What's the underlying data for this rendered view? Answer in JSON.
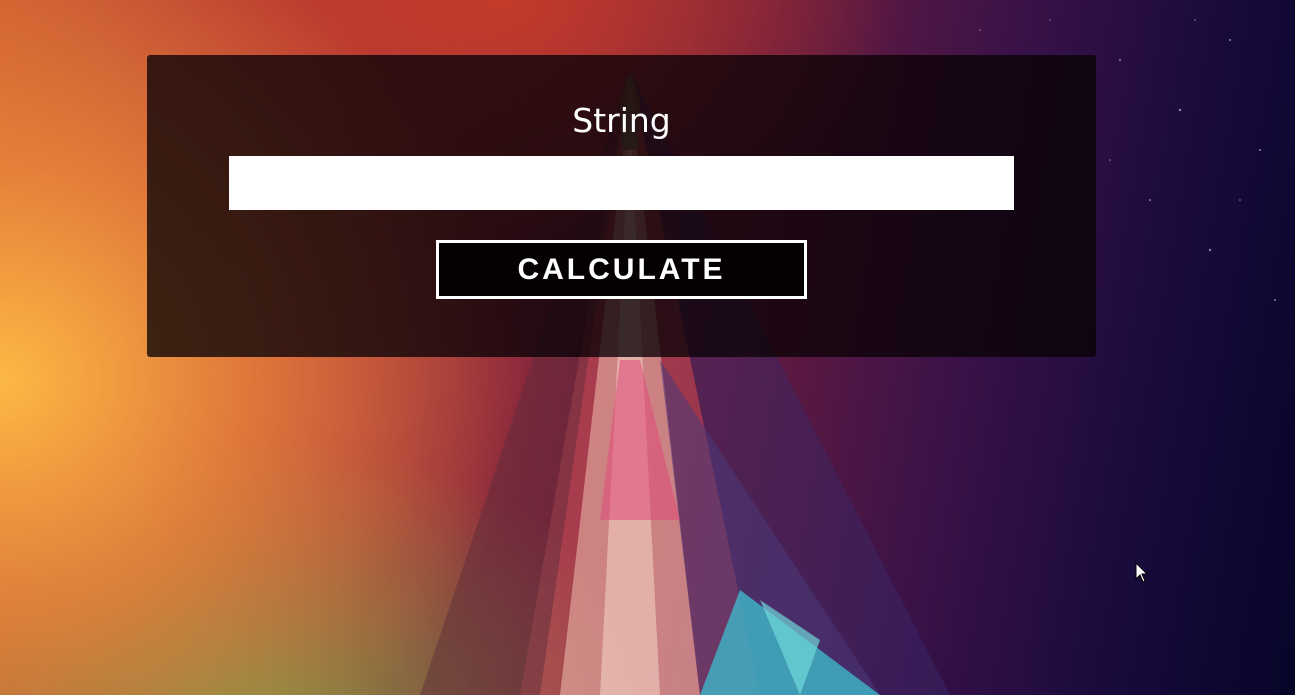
{
  "form": {
    "field_label": "String",
    "input_value": "",
    "input_placeholder": "",
    "submit_label": "CALCULATE"
  },
  "icons": {
    "pointer": "mouse-pointer-icon"
  },
  "colors": {
    "panel_bg": "#0a0206",
    "button_border": "#ffffff",
    "text": "#ffffff"
  }
}
